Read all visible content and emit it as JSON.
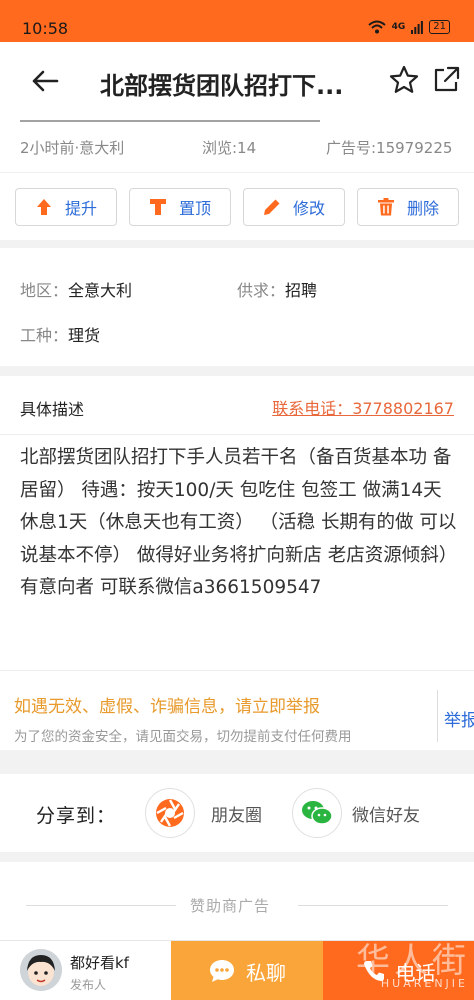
{
  "status_bar": {
    "time": "10:58",
    "signal": "4G",
    "battery": "21"
  },
  "header": {
    "title": "北部摆货团队招打下...",
    "back_icon": "arrow-left-icon",
    "favorite_icon": "star-icon",
    "share_icon": "share-icon"
  },
  "meta": {
    "time_place": "2小时前·意大利",
    "views": "浏览:14",
    "ad_number": "广告号:15979225"
  },
  "actions": [
    {
      "label": "提升",
      "icon": "arrow-up-icon",
      "color": "#ff6a1f"
    },
    {
      "label": "置顶",
      "icon": "pin-top-icon",
      "color": "#ff6a1f"
    },
    {
      "label": "修改",
      "icon": "pencil-icon",
      "color": "#ff6a1f"
    },
    {
      "label": "删除",
      "icon": "trash-icon",
      "color": "#ff6a1f"
    }
  ],
  "info": {
    "region_label": "地区：",
    "region_value": "全意大利",
    "supply_label": "供求：",
    "supply_value": "招聘",
    "job_label": "工种：",
    "job_value": "理货"
  },
  "description": {
    "heading": "具体描述",
    "phone": "联系电话：3778802167",
    "text": "北部摆货团队招打下手人员若干名（备百货基本功 备居留） 待遇：按天100/天 包吃住 包签工 做满14天休息1天（休息天也有工资） （活稳 长期有的做 可以说基本不停） 做得好业务将扩向新店 老店资源倾斜）有意向者 可联系微信a3661509547"
  },
  "warning": {
    "title": "如遇无效、虚假、诈骗信息，请立即举报",
    "subtitle": "为了您的资金安全，请见面交易，切勿提前支付任何费用",
    "report": "举报"
  },
  "share": {
    "label": "分享到：",
    "moments": "朋友圈",
    "wechat": "微信好友"
  },
  "sponsor": {
    "label": "赞助商广告"
  },
  "bottom": {
    "poster_name": "都好看kf",
    "poster_role": "发布人",
    "chat": "私聊",
    "call": "电话",
    "watermark": "华人街",
    "watermark_sub": "HUARENJIE"
  },
  "colors": {
    "brand": "#ff6a1f",
    "chat": "#f9a53a",
    "link": "#2c6bd8",
    "warning": "#e89a2c"
  }
}
